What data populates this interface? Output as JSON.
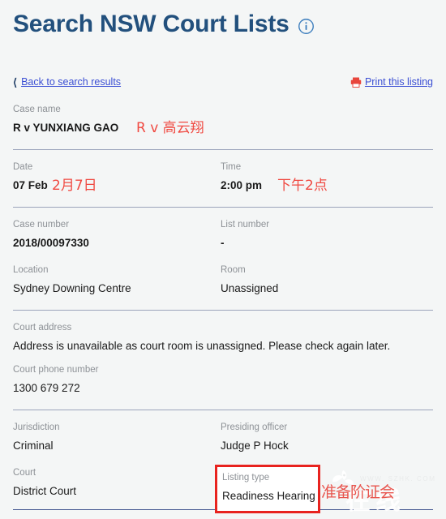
{
  "header": {
    "title": "Search NSW Court Lists",
    "info_icon": "info-circle-icon"
  },
  "nav": {
    "back_label": "Back to search results",
    "back_chevron": "chevron-left-icon",
    "print_label": "Print this listing",
    "print_icon": "printer-icon"
  },
  "fields": {
    "case_name": {
      "label": "Case name",
      "value": "R v YUNXIANG GAO"
    },
    "date": {
      "label": "Date",
      "value": "07 Feb"
    },
    "time": {
      "label": "Time",
      "value": "2:00 pm"
    },
    "case_number": {
      "label": "Case number",
      "value": "2018/00097330"
    },
    "list_number": {
      "label": "List number",
      "value": "-"
    },
    "location": {
      "label": "Location",
      "value": "Sydney Downing Centre"
    },
    "room": {
      "label": "Room",
      "value": "Unassigned"
    },
    "court_address": {
      "label": "Court address",
      "value": "Address is unavailable as court room is unassigned. Please check again later."
    },
    "court_phone": {
      "label": "Court phone number",
      "value": "1300 679 272"
    },
    "jurisdiction": {
      "label": "Jurisdiction",
      "value": "Criminal"
    },
    "presiding_officer": {
      "label": "Presiding officer",
      "value": "Judge P Hock"
    },
    "court": {
      "label": "Court",
      "value": "District Court"
    },
    "listing_type": {
      "label": "Listing type",
      "value": "Readiness Hearing"
    }
  },
  "annotations": {
    "case_name_cn": "R v 高云翔",
    "date_cn": "2月7日",
    "time_cn": "下午2点",
    "listing_type_cn": "准备阶证会"
  },
  "watermark": {
    "url": "WWW. SZHK. COM",
    "text": "在线",
    "logo": "flower-logo-icon"
  },
  "colors": {
    "title": "#22507d",
    "link": "#3b4fd4",
    "label": "#8d9196",
    "value": "#1a1a1a",
    "annotation_red": "#f04a42",
    "highlight_border": "#e8231f",
    "background": "#f4f6f6"
  }
}
